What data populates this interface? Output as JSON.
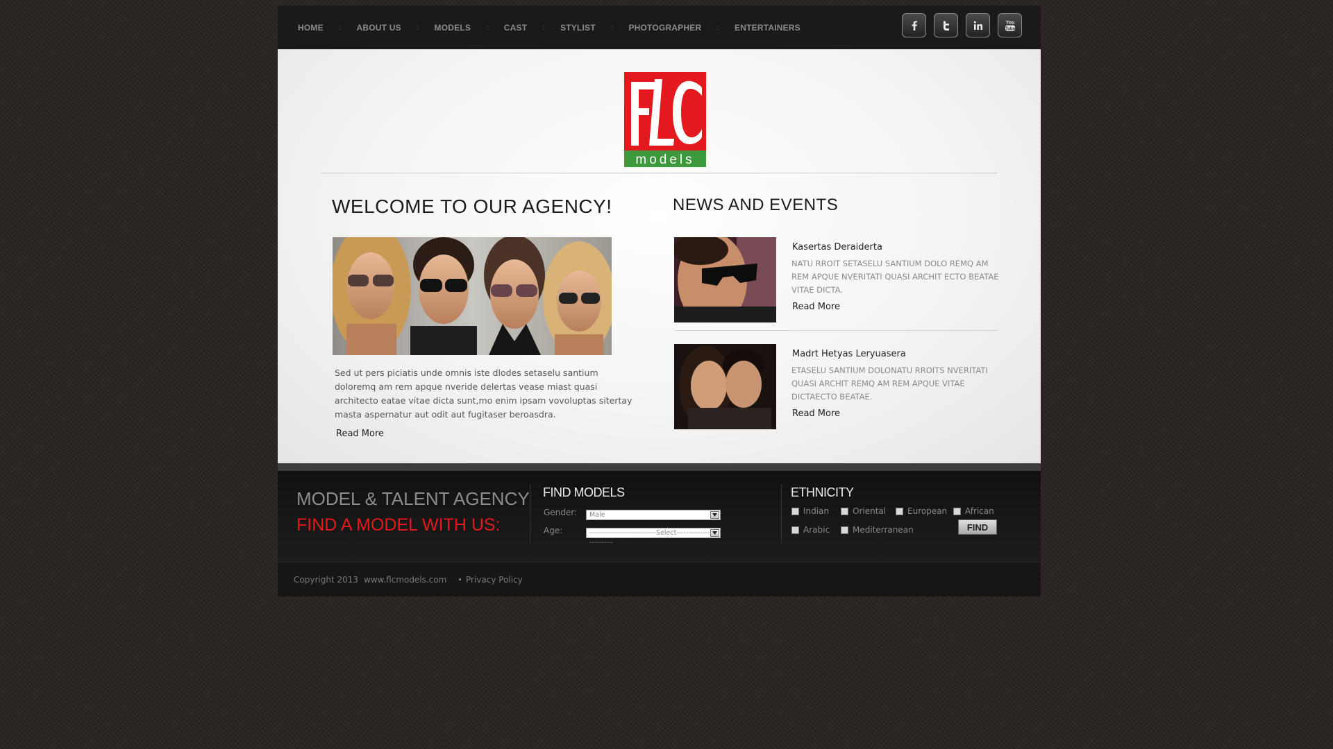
{
  "nav": {
    "items": [
      "HOME",
      "ABOUT US",
      "MODELS",
      "CAST",
      "STYLIST",
      "PHOTOGRAPHER",
      "ENTERTAINERS"
    ],
    "separator": ":"
  },
  "social": [
    {
      "icon": "facebook-icon",
      "glyph": "f"
    },
    {
      "icon": "twitter-icon",
      "glyph": "t"
    },
    {
      "icon": "linkedin-icon",
      "glyph": "in"
    },
    {
      "icon": "youtube-icon",
      "glyph": "You"
    }
  ],
  "logo": {
    "letters": "FLC",
    "word": "models",
    "red": "#e3191e",
    "green": "#3c9a3c"
  },
  "welcome": {
    "title": "WELCOME TO OUR AGENCY!",
    "text": "Sed ut pers piciatis unde omnis iste dlodes setaselu santium doloremq am rem apque nveride delertas vease miast quasi architecto eatae vitae dicta sunt,mo enim ipsam vovoluptas sitertay masta aspernatur aut odit aut fugitaser beroasdra.",
    "read_more": "Read More"
  },
  "news": {
    "title": "NEWS AND EVENTS",
    "items": [
      {
        "heading": "Kasertas Deraiderta",
        "body": "NATU RROIT SETASELU SANTIUM DOLO REMQ AM REM APQUE NVERITATI QUASI ARCHIT ECTO BEATAE VITAE DICTA.",
        "read_more": "Read More"
      },
      {
        "heading": "Madrt Hetyas Leryuasera",
        "body": "ETASELU SANTIUM DOLONATU RROITS NVERITATI QUASI ARCHIT REMQ AM REM APQUE VITAE DICTAECTO BEATAE.",
        "read_more": "Read More"
      }
    ]
  },
  "footer": {
    "tagline1": "MODEL & TALENT AGENCY",
    "tagline2": "FIND A MODEL WITH US:",
    "find_title": "FIND MODELS",
    "gender_label": "Gender:",
    "gender_value": "Male",
    "age_label": "Age:",
    "age_value": "----------------------------Select----------------------------",
    "ethnicity_title": "ETHNICITY",
    "ethnicities": [
      "Indian",
      "Oriental",
      "European",
      "African",
      "Arabic",
      "Mediterranean"
    ],
    "find_button": "FIND",
    "accent": "#e3191e"
  },
  "bottom": {
    "copyright": "Copyright 2013",
    "site": "www.flcmodels.com",
    "privacy": "Privacy  Policy"
  }
}
